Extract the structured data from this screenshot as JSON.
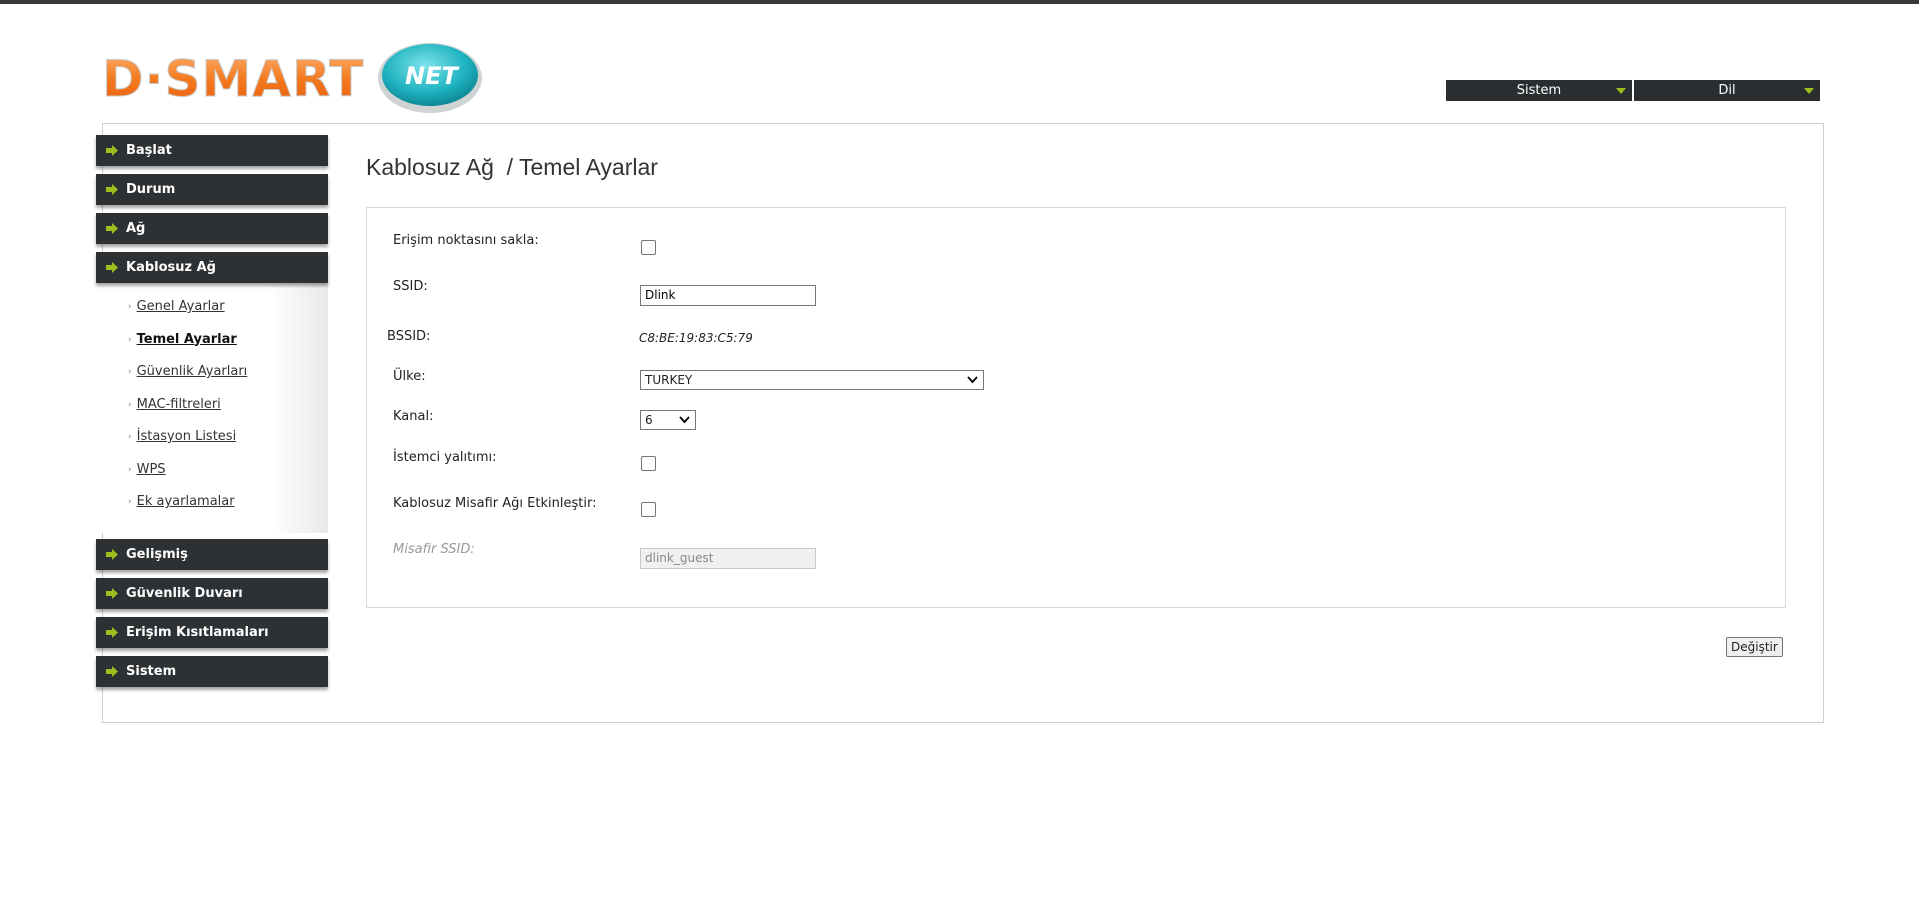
{
  "brand": {
    "logo_text": "D·SMART",
    "logo_badge": "NET"
  },
  "top_menus": [
    {
      "label": "Sistem"
    },
    {
      "label": "Dil"
    }
  ],
  "sidebar": {
    "items": [
      {
        "label": "Başlat"
      },
      {
        "label": "Durum"
      },
      {
        "label": "Ağ"
      },
      {
        "label": "Kablosuz Ağ"
      },
      {
        "label": "Gelişmiş"
      },
      {
        "label": "Güvenlik Duvarı"
      },
      {
        "label": "Erişim Kısıtlamaları"
      },
      {
        "label": "Sistem"
      }
    ],
    "subitems": [
      {
        "label": "Genel Ayarlar"
      },
      {
        "label": "Temel Ayarlar"
      },
      {
        "label": "Güvenlik Ayarları"
      },
      {
        "label": "MAC-filtreleri"
      },
      {
        "label": "İstasyon Listesi"
      },
      {
        "label": "WPS"
      },
      {
        "label": "Ek ayarlamalar"
      }
    ]
  },
  "page": {
    "title": "Kablosuz Ağ  / Temel Ayarlar"
  },
  "form": {
    "hide_ap": {
      "label": "Erişim noktasını sakla:"
    },
    "ssid": {
      "label": "SSID:",
      "value": "Dlink"
    },
    "bssid": {
      "label": "BSSID:",
      "value": "C8:BE:19:83:C5:79"
    },
    "country": {
      "label": "Ülke:",
      "value": "TURKEY"
    },
    "channel": {
      "label": "Kanal:",
      "value": "6"
    },
    "client_isolation": {
      "label": "İstemci yalıtımı:"
    },
    "guest_enable": {
      "label": "Kablosuz Misafir Ağı Etkinleştir:"
    },
    "guest_ssid": {
      "label": "Misafir SSID:",
      "value": "dlink_guest"
    }
  },
  "actions": {
    "apply_label": "Değiştir"
  },
  "colors": {
    "nav_bg": "#2d3133",
    "accent": "#9bbf1d",
    "logo_orange": "#f07a20",
    "logo_teal": "#1fb3c0"
  }
}
